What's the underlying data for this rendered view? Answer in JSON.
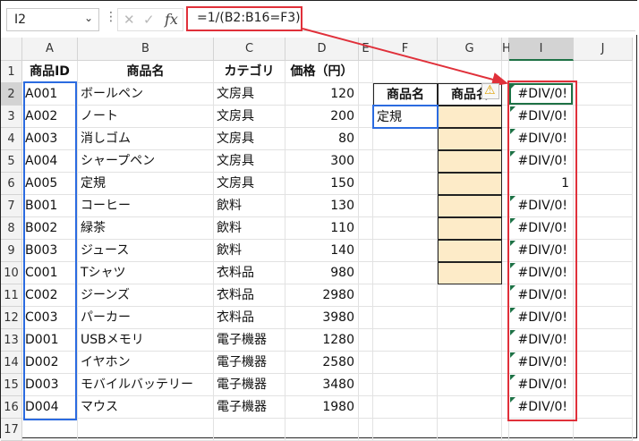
{
  "name_box": {
    "value": "I2",
    "dropdown_icon": "chevron-down-icon"
  },
  "formula_bar": {
    "cancel_icon": "close-icon",
    "enter_icon": "check-icon",
    "fx_label": "fx",
    "formula": "=1/(B2:B16=F3)"
  },
  "columns": [
    "A",
    "B",
    "C",
    "D",
    "E",
    "F",
    "G",
    "H",
    "I",
    "J"
  ],
  "rows": [
    "1",
    "2",
    "3",
    "4",
    "5",
    "6",
    "7",
    "8",
    "9",
    "10",
    "11",
    "12",
    "13",
    "14",
    "15",
    "16",
    "17"
  ],
  "headers": {
    "id": "商品ID",
    "name": "商品名",
    "category": "カテゴリ",
    "price": "価格（円）"
  },
  "products": [
    {
      "id": "A001",
      "name": "ボールペン",
      "category": "文房具",
      "price": "120"
    },
    {
      "id": "A002",
      "name": "ノート",
      "category": "文房具",
      "price": "200"
    },
    {
      "id": "A003",
      "name": "消しゴム",
      "category": "文房具",
      "price": "80"
    },
    {
      "id": "A004",
      "name": "シャープペン",
      "category": "文房具",
      "price": "300"
    },
    {
      "id": "A005",
      "name": "定規",
      "category": "文房具",
      "price": "150"
    },
    {
      "id": "B001",
      "name": "コーヒー",
      "category": "飲料",
      "price": "130"
    },
    {
      "id": "B002",
      "name": "緑茶",
      "category": "飲料",
      "price": "110"
    },
    {
      "id": "B003",
      "name": "ジュース",
      "category": "飲料",
      "price": "140"
    },
    {
      "id": "C001",
      "name": "Tシャツ",
      "category": "衣料品",
      "price": "980"
    },
    {
      "id": "C002",
      "name": "ジーンズ",
      "category": "衣料品",
      "price": "2980"
    },
    {
      "id": "C003",
      "name": "パーカー",
      "category": "衣料品",
      "price": "3980"
    },
    {
      "id": "D001",
      "name": "USBメモリ",
      "category": "電子機器",
      "price": "1280"
    },
    {
      "id": "D002",
      "name": "イヤホン",
      "category": "電子機器",
      "price": "2580"
    },
    {
      "id": "D003",
      "name": "モバイルバッテリー",
      "category": "電子機器",
      "price": "3480"
    },
    {
      "id": "D004",
      "name": "マウス",
      "category": "電子機器",
      "price": "1980"
    }
  ],
  "lookup": {
    "f_header": "商品名",
    "g_header": "商品名",
    "f_value": "定規",
    "warning_icon": "warning-icon"
  },
  "results": [
    "#DIV/0!",
    "#DIV/0!",
    "#DIV/0!",
    "#DIV/0!",
    "1",
    "#DIV/0!",
    "#DIV/0!",
    "#DIV/0!",
    "#DIV/0!",
    "#DIV/0!",
    "#DIV/0!",
    "#DIV/0!",
    "#DIV/0!",
    "#DIV/0!",
    "#DIV/0!"
  ],
  "colors": {
    "highlight_blue": "#2b6be0",
    "highlight_red": "#e0303a",
    "input_fill": "#fdebc8",
    "error_flag": "#1e7145"
  }
}
